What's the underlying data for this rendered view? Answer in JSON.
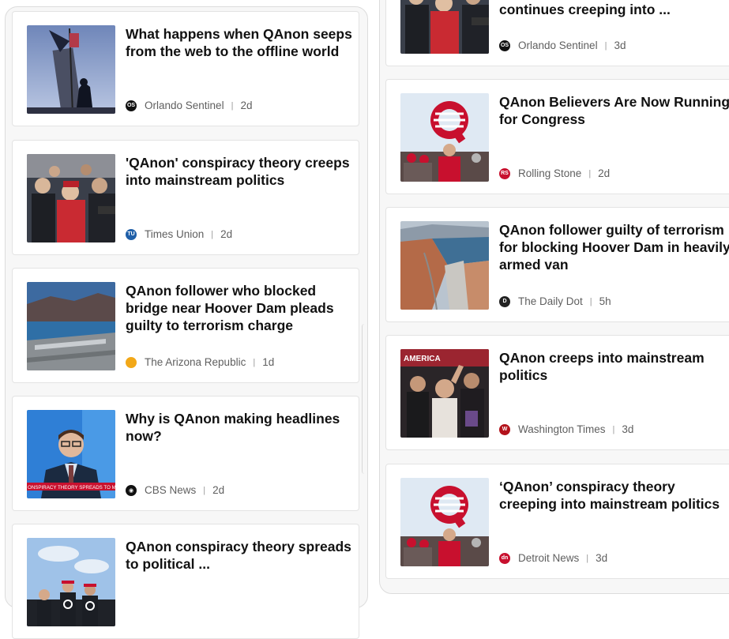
{
  "left_column": [
    {
      "title": "What happens when QAnon seeps from the web to the offline world",
      "source": "Orlando Sentinel",
      "age": "2d",
      "logo_text": "OS",
      "logo_color": "#111111",
      "thumb": "flag-pole"
    },
    {
      "title": "'QAnon' conspiracy theory creeps into mainstream politics",
      "source": "Times Union",
      "age": "2d",
      "logo_text": "TU",
      "logo_color": "#1f5fa8",
      "thumb": "crowd-red"
    },
    {
      "title": "QAnon follower who blocked bridge near Hoover Dam pleads guilty to terrorism charge",
      "source": "The Arizona Republic",
      "age": "1d",
      "logo_text": "",
      "logo_color": "#f2a818",
      "thumb": "dam-blue"
    },
    {
      "title": "Why is QAnon making headlines now?",
      "source": "CBS News",
      "age": "2d",
      "logo_text": "◉",
      "logo_color": "#111111",
      "thumb": "news-anchor",
      "ticker": "ONSPIRACY THEORY SPREADS TO MAINSTR"
    },
    {
      "title": "QAnon conspiracy theory spreads to political ...",
      "source": "",
      "age": "",
      "logo_text": "",
      "logo_color": "#ffffff",
      "thumb": "q-shirts"
    }
  ],
  "right_column": [
    {
      "title": "continues creeping into ...",
      "source": "Orlando Sentinel",
      "age": "3d",
      "logo_text": "OS",
      "logo_color": "#111111",
      "thumb": "crowd-red"
    },
    {
      "title": "QAnon Believers Are Now Running for Congress",
      "source": "Rolling Stone",
      "age": "2d",
      "logo_text": "RS",
      "logo_color": "#c8102e",
      "thumb": "q-sign"
    },
    {
      "title": "QAnon follower guilty of terrorism for blocking Hoover Dam in heavily armed van",
      "source": "The Daily Dot",
      "age": "5h",
      "logo_text": "D",
      "logo_color": "#222222",
      "thumb": "dam-aerial"
    },
    {
      "title": "QAnon creeps into mainstream politics",
      "source": "Washington Times",
      "age": "3d",
      "logo_text": "W",
      "logo_color": "#b3121b",
      "thumb": "rally"
    },
    {
      "title": "‘QAnon’ conspiracy theory creeping into mainstream politics",
      "source": "Detroit News",
      "age": "3d",
      "logo_text": "dn",
      "logo_color": "#c8102e",
      "thumb": "q-sign"
    }
  ],
  "separator": "|"
}
